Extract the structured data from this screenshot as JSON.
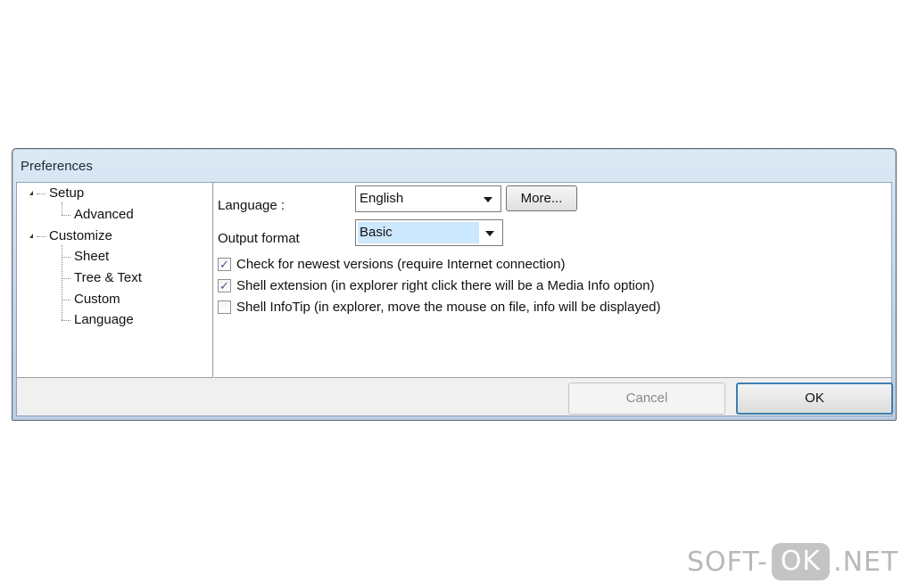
{
  "window": {
    "title": "Preferences"
  },
  "tree": {
    "items": [
      {
        "label": "Setup",
        "level": 0,
        "expanded": true
      },
      {
        "label": "Advanced",
        "level": 1
      },
      {
        "label": "Customize",
        "level": 0,
        "expanded": true
      },
      {
        "label": "Sheet",
        "level": 1
      },
      {
        "label": "Tree & Text",
        "level": 1
      },
      {
        "label": "Custom",
        "level": 1
      },
      {
        "label": "Language",
        "level": 1
      }
    ]
  },
  "panel": {
    "language_label": "Language :",
    "language_value": "English",
    "more_button": "More...",
    "output_label": "Output format",
    "output_value": "Basic",
    "checks": [
      {
        "label": "Check for newest versions (require Internet connection)",
        "checked": true
      },
      {
        "label": "Shell extension (in explorer right click there will be a Media Info option)",
        "checked": true
      },
      {
        "label": "Shell InfoTip (in explorer, move the mouse on file, info will be displayed)",
        "checked": false
      }
    ]
  },
  "footer": {
    "cancel": "Cancel",
    "ok": "OK"
  },
  "watermark": {
    "prefix": "SOFT-",
    "badge": "OK",
    "suffix": ".NET"
  },
  "colors": {
    "accent": "#3c7fb1",
    "selection": "#cce8ff",
    "titlebar": "#c3d6ea"
  }
}
